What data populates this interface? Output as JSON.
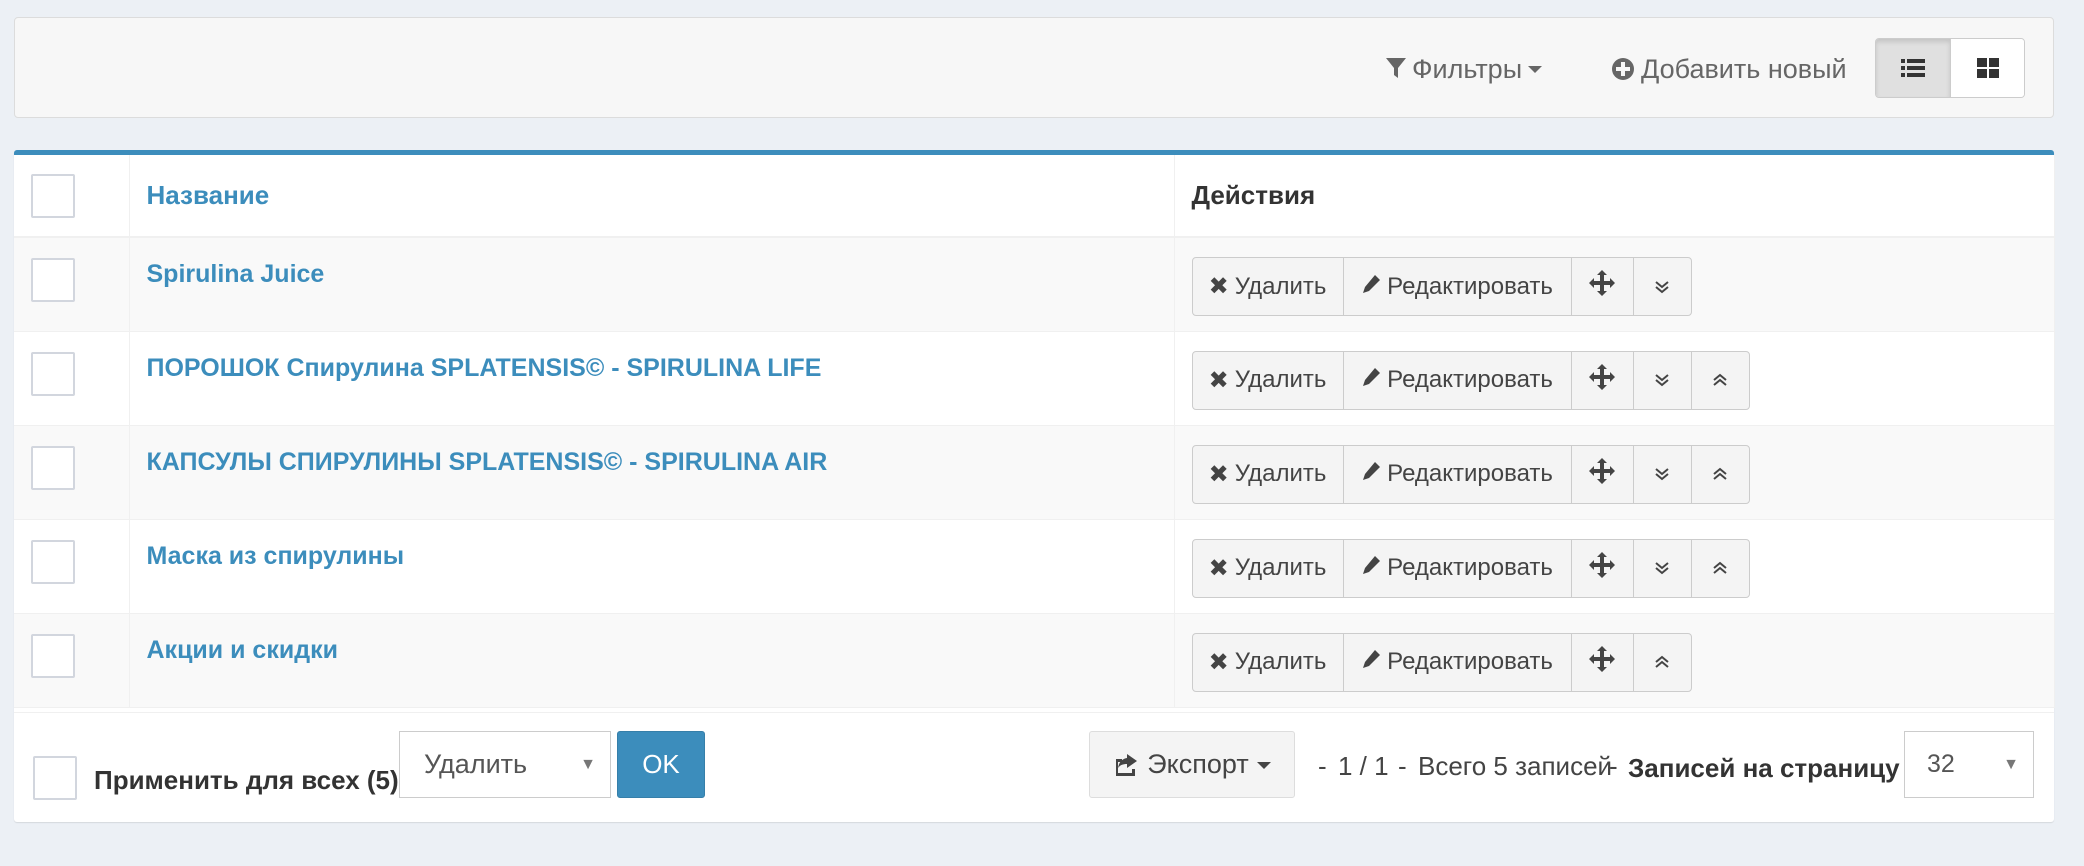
{
  "toolbar": {
    "filters_label": "Фильтры",
    "add_new_label": "Добавить новый",
    "view_modes": [
      "list",
      "grid"
    ],
    "active_view": "list"
  },
  "table": {
    "columns": {
      "name": "Название",
      "actions": "Действия"
    },
    "rows": [
      {
        "name": "Spirulina Juice",
        "actions": {
          "delete": "Удалить",
          "edit": "Редактировать",
          "move": "move-icon",
          "down": true,
          "up": false
        }
      },
      {
        "name": "ПОРОШОК Спирулина SPLATENSIS© - SPIRULINA LIFE",
        "actions": {
          "delete": "Удалить",
          "edit": "Редактировать",
          "move": "move-icon",
          "down": true,
          "up": true
        }
      },
      {
        "name": "КАПСУЛЫ СПИРУЛИНЫ SPLATENSIS© - SPIRULINA AIR",
        "actions": {
          "delete": "Удалить",
          "edit": "Редактировать",
          "move": "move-icon",
          "down": true,
          "up": true
        }
      },
      {
        "name": "Маска из спирулины",
        "actions": {
          "delete": "Удалить",
          "edit": "Редактировать",
          "move": "move-icon",
          "down": true,
          "up": true
        }
      },
      {
        "name": "Акции и скидки",
        "actions": {
          "delete": "Удалить",
          "edit": "Редактировать",
          "move": "move-icon",
          "down": false,
          "up": true
        }
      }
    ]
  },
  "footer": {
    "apply_all_label": "Применить для всех (5)",
    "bulk_action_value": "Удалить",
    "ok_label": "OK",
    "export_label": "Экспорт",
    "sep1": "-",
    "page_info": "1 / 1",
    "sep2": "-",
    "total_label": "Всего 5 записей",
    "sep3": "-",
    "per_page_label": "Записей на страницу",
    "per_page_value": "32"
  },
  "colors": {
    "accent": "#3c8dbc",
    "background": "#ecf0f5"
  }
}
